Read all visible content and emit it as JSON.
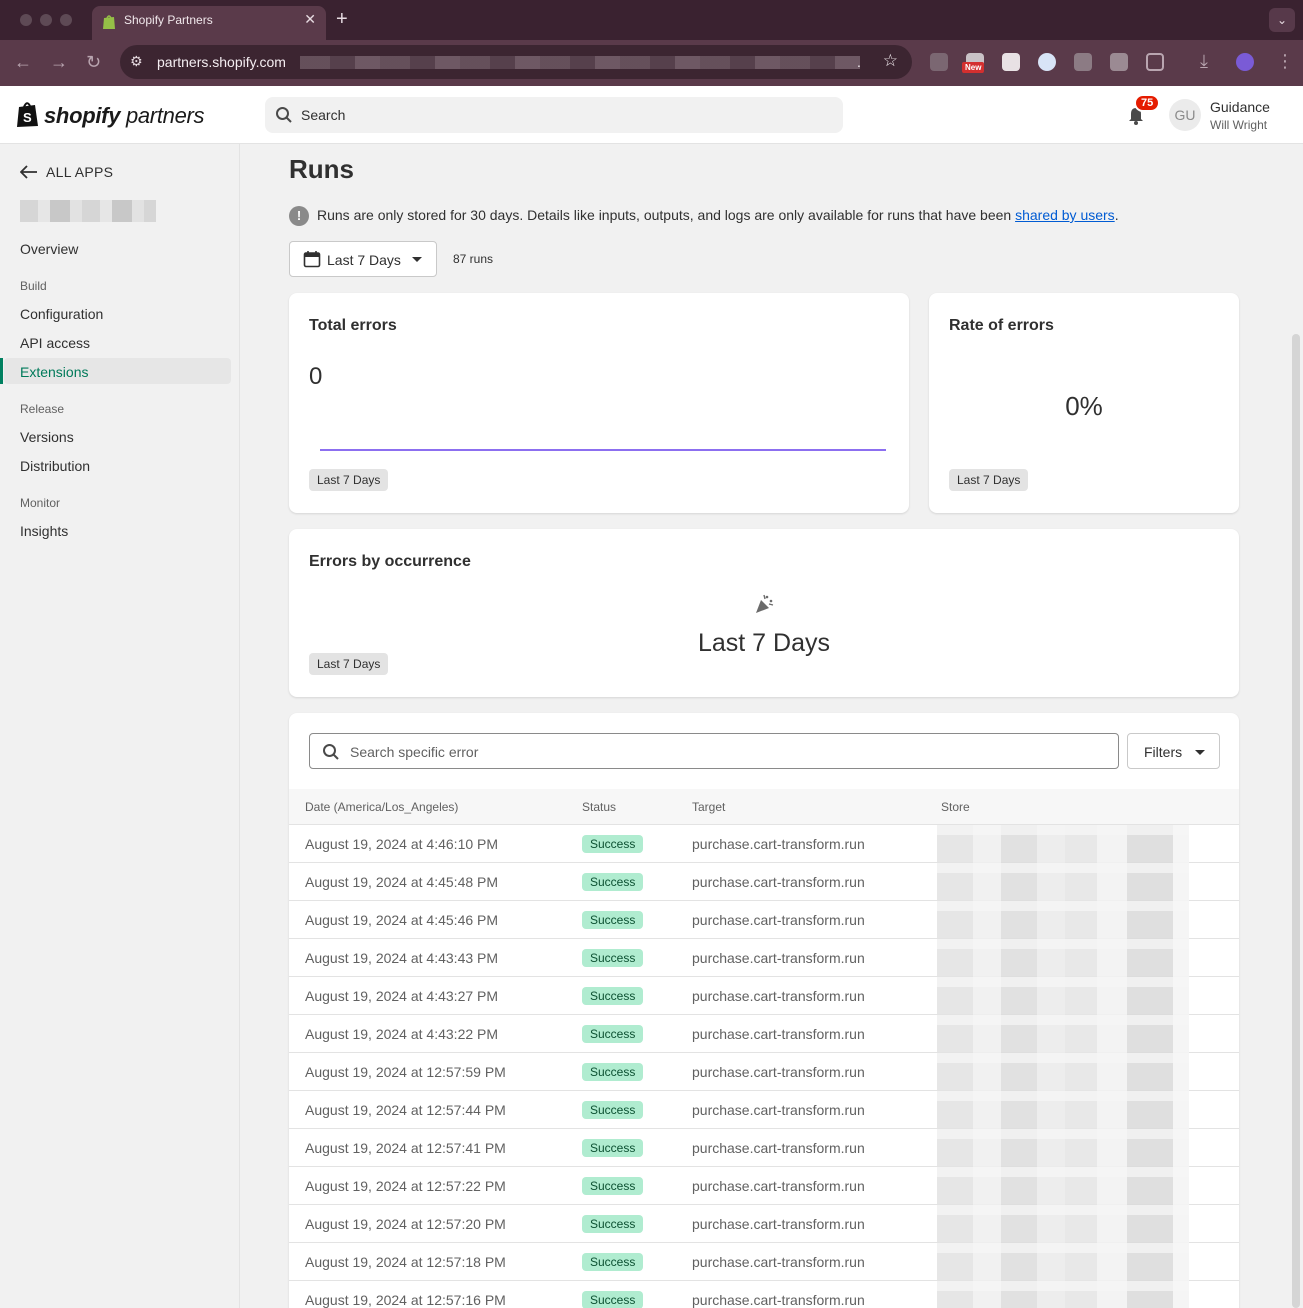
{
  "browser": {
    "tab_title": "Shopify Partners",
    "url": "partners.shopify.com",
    "url_suffix": ".",
    "ext_new_badge": "New"
  },
  "topbar": {
    "logo_bold": "shopify",
    "logo_light": "partners",
    "search_placeholder": "Search",
    "notification_count": "75",
    "avatar_initials": "GU",
    "user_name": "Guidance",
    "user_sub": "Will Wright"
  },
  "sidebar": {
    "back_label": "ALL APPS",
    "items": {
      "overview": "Overview",
      "group_build": "Build",
      "configuration": "Configuration",
      "api_access": "API access",
      "extensions": "Extensions",
      "group_release": "Release",
      "versions": "Versions",
      "distribution": "Distribution",
      "group_monitor": "Monitor",
      "insights": "Insights"
    }
  },
  "page": {
    "title": "Runs",
    "info_text": "Runs are only stored for 30 days. Details like inputs, outputs, and logs are only available for runs that have been ",
    "info_link": "shared by users",
    "info_end": ".",
    "date_filter": "Last 7 Days",
    "runs_count": "87 runs"
  },
  "cards": {
    "total_errors": {
      "title": "Total errors",
      "value": "0",
      "period": "Last 7 Days"
    },
    "rate_of_errors": {
      "title": "Rate of errors",
      "value": "0%",
      "period": "Last 7 Days"
    },
    "errors_by_occurrence": {
      "title": "Errors by occurrence",
      "empty_title": "Last 7 Days",
      "period": "Last 7 Days"
    }
  },
  "table": {
    "search_placeholder": "Search specific error",
    "filters_label": "Filters",
    "headers": {
      "date": "Date (America/Los_Angeles)",
      "status": "Status",
      "target": "Target",
      "store": "Store"
    },
    "rows": [
      {
        "date": "August 19, 2024 at 4:46:10 PM",
        "status": "Success",
        "target": "purchase.cart-transform.run"
      },
      {
        "date": "August 19, 2024 at 4:45:48 PM",
        "status": "Success",
        "target": "purchase.cart-transform.run"
      },
      {
        "date": "August 19, 2024 at 4:45:46 PM",
        "status": "Success",
        "target": "purchase.cart-transform.run"
      },
      {
        "date": "August 19, 2024 at 4:43:43 PM",
        "status": "Success",
        "target": "purchase.cart-transform.run"
      },
      {
        "date": "August 19, 2024 at 4:43:27 PM",
        "status": "Success",
        "target": "purchase.cart-transform.run"
      },
      {
        "date": "August 19, 2024 at 4:43:22 PM",
        "status": "Success",
        "target": "purchase.cart-transform.run"
      },
      {
        "date": "August 19, 2024 at 12:57:59 PM",
        "status": "Success",
        "target": "purchase.cart-transform.run"
      },
      {
        "date": "August 19, 2024 at 12:57:44 PM",
        "status": "Success",
        "target": "purchase.cart-transform.run"
      },
      {
        "date": "August 19, 2024 at 12:57:41 PM",
        "status": "Success",
        "target": "purchase.cart-transform.run"
      },
      {
        "date": "August 19, 2024 at 12:57:22 PM",
        "status": "Success",
        "target": "purchase.cart-transform.run"
      },
      {
        "date": "August 19, 2024 at 12:57:20 PM",
        "status": "Success",
        "target": "purchase.cart-transform.run"
      },
      {
        "date": "August 19, 2024 at 12:57:18 PM",
        "status": "Success",
        "target": "purchase.cart-transform.run"
      },
      {
        "date": "August 19, 2024 at 12:57:16 PM",
        "status": "Success",
        "target": "purchase.cart-transform.run"
      }
    ]
  },
  "colors": {
    "brand_green": "#008060",
    "active_nav_text": "#007a5a",
    "link_blue": "#005bd3",
    "chart_line": "#8c6ff0",
    "success_bg": "#b0ecd0",
    "success_text": "#0c5132",
    "badge_red": "#e51c00"
  }
}
